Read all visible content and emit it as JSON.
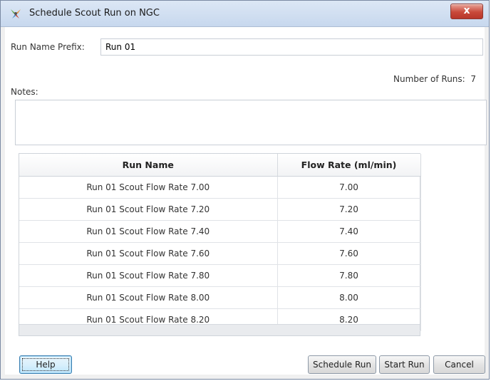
{
  "window": {
    "title": "Schedule Scout Run on NGC",
    "close_glyph": "x",
    "icon": "ngc-app-icon"
  },
  "form": {
    "prefix_label": "Run Name Prefix:",
    "prefix_value": "Run 01",
    "number_of_runs_label": "Number of Runs:",
    "number_of_runs_value": "7",
    "notes_label": "Notes:",
    "notes_value": ""
  },
  "table": {
    "columns": [
      "Run Name",
      "Flow Rate (ml/min)"
    ],
    "rows": [
      {
        "run_name": "Run 01 Scout Flow Rate 7.00",
        "flow_rate": "7.00"
      },
      {
        "run_name": "Run 01 Scout Flow Rate 7.20",
        "flow_rate": "7.20"
      },
      {
        "run_name": "Run 01 Scout Flow Rate 7.40",
        "flow_rate": "7.40"
      },
      {
        "run_name": "Run 01 Scout Flow Rate 7.60",
        "flow_rate": "7.60"
      },
      {
        "run_name": "Run 01 Scout Flow Rate 7.80",
        "flow_rate": "7.80"
      },
      {
        "run_name": "Run 01 Scout Flow Rate 8.00",
        "flow_rate": "8.00"
      },
      {
        "run_name": "Run 01 Scout Flow Rate 8.20",
        "flow_rate": "8.20"
      }
    ]
  },
  "buttons": {
    "help": "Help",
    "schedule_run": "Schedule Run",
    "start_run": "Start Run",
    "cancel": "Cancel"
  },
  "colors": {
    "titlebar": "#c7d8ee",
    "close_button": "#c9493a",
    "focused_button": "#bee6fd"
  }
}
